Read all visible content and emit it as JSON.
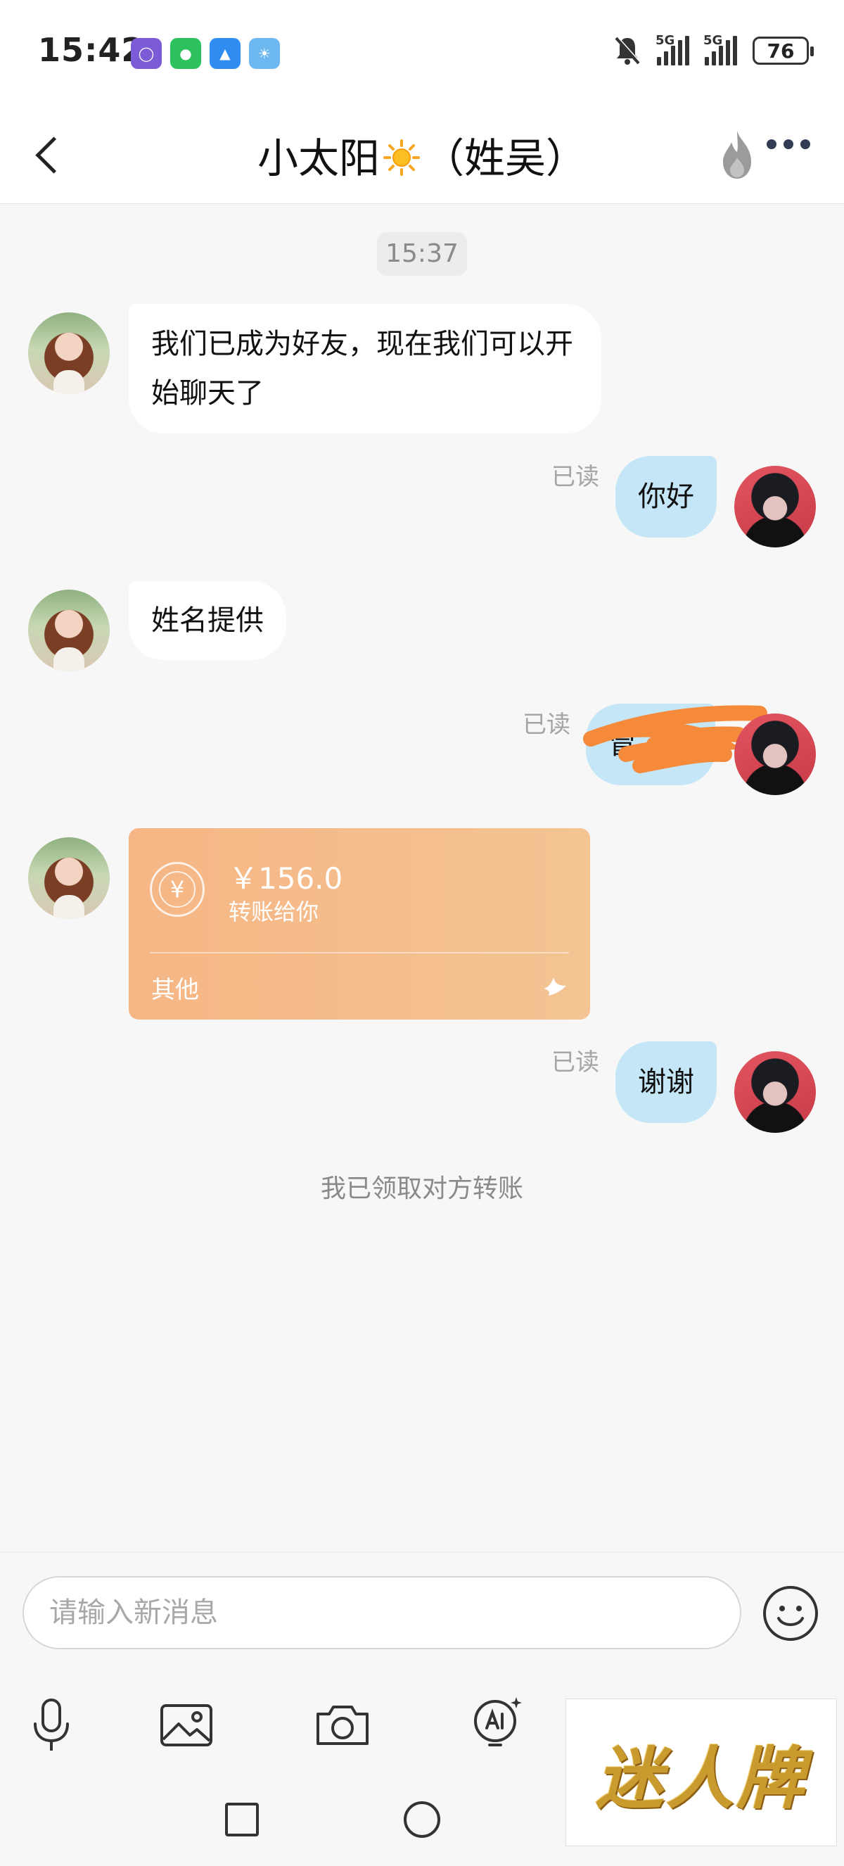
{
  "status_bar": {
    "time": "15:42",
    "apps": [
      {
        "icon": "shield-app-icon",
        "color": "#7b5cd6"
      },
      {
        "icon": "wechat-icon",
        "color": "#2dc15e"
      },
      {
        "icon": "app-market-icon",
        "color": "#2f8cf0"
      },
      {
        "icon": "weather-icon",
        "color": "#6db8f0"
      }
    ],
    "signal_1": "5G",
    "signal_2": "5G",
    "battery": "76"
  },
  "header": {
    "title_prefix": "小太阳",
    "title_suffix": "（姓吴）"
  },
  "chat": {
    "timestamp": "15:37",
    "messages": [
      {
        "text": "我们已成为好友，现在我们可以开始聊天了"
      },
      {
        "text": "你好",
        "status": "已读"
      },
      {
        "text": "姓名提供"
      },
      {
        "text": "冒",
        "status": "已读"
      },
      {
        "text": "谢谢",
        "status": "已读"
      }
    ],
    "transfer": {
      "amount": "￥156.0",
      "subtitle": "转账给你",
      "label": "其他",
      "icon_char": "¥"
    },
    "notice": "我已领取对方转账"
  },
  "composer": {
    "placeholder": "请输入新消息"
  },
  "watermark": {
    "text": "迷人牌"
  }
}
